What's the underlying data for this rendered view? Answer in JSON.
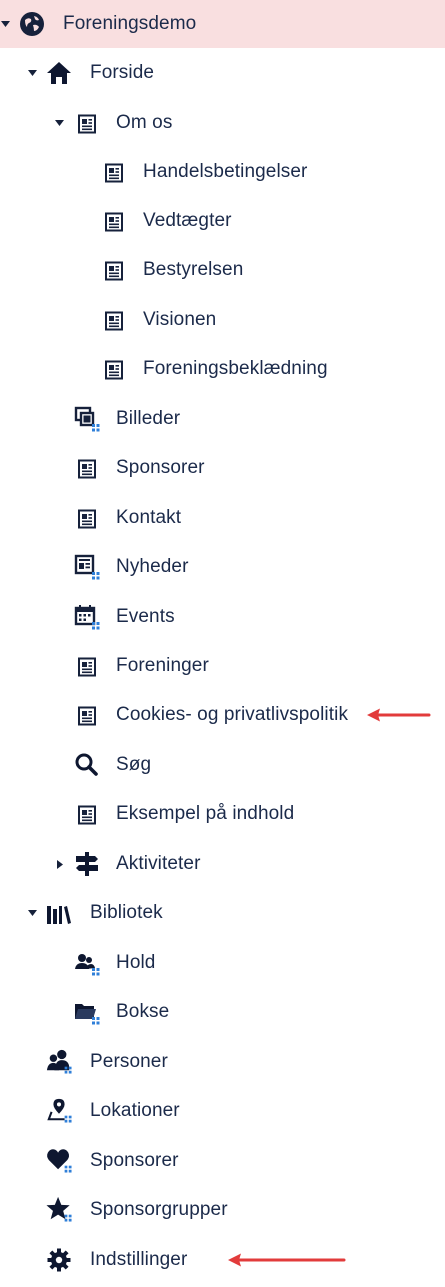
{
  "tree": {
    "root": {
      "label": "Foreningsdemo",
      "icon": "globe-icon"
    },
    "forside": {
      "label": "Forside",
      "icon": "home-icon"
    },
    "om_os": {
      "label": "Om os",
      "icon": "page-icon"
    },
    "om_os_children": [
      {
        "label": "Handelsbetingelser",
        "icon": "page-icon"
      },
      {
        "label": "Vedtægter",
        "icon": "page-icon"
      },
      {
        "label": "Bestyrelsen",
        "icon": "page-icon"
      },
      {
        "label": "Visionen",
        "icon": "page-icon"
      },
      {
        "label": "Foreningsbeklædning",
        "icon": "page-icon"
      }
    ],
    "forside_children": [
      {
        "label": "Billeder",
        "icon": "gallery-icon"
      },
      {
        "label": "Sponsorer",
        "icon": "page-icon"
      },
      {
        "label": "Kontakt",
        "icon": "page-icon"
      },
      {
        "label": "Nyheder",
        "icon": "news-icon"
      },
      {
        "label": "Events",
        "icon": "calendar-icon"
      },
      {
        "label": "Foreninger",
        "icon": "page-icon"
      },
      {
        "label": "Cookies- og privatlivspolitik",
        "icon": "page-icon"
      },
      {
        "label": "Søg",
        "icon": "search-icon"
      },
      {
        "label": "Eksempel på indhold",
        "icon": "page-icon"
      },
      {
        "label": "Aktiviteter",
        "icon": "signpost-icon"
      }
    ],
    "bibliotek": {
      "label": "Bibliotek",
      "icon": "library-icon"
    },
    "bibliotek_children": [
      {
        "label": "Hold",
        "icon": "team-icon"
      },
      {
        "label": "Bokse",
        "icon": "folder-icon"
      }
    ],
    "top_level": [
      {
        "label": "Personer",
        "icon": "people-icon"
      },
      {
        "label": "Lokationer",
        "icon": "location-icon"
      },
      {
        "label": "Sponsorer",
        "icon": "heart-icon"
      },
      {
        "label": "Sponsorgrupper",
        "icon": "star-icon"
      },
      {
        "label": "Indstillinger",
        "icon": "gear-icon"
      }
    ]
  },
  "colors": {
    "text": "#1b2a4a",
    "active_background": "#f9dfe0",
    "annotation_arrow": "#e23b3b",
    "icon_badge": "#2f7fd8"
  }
}
